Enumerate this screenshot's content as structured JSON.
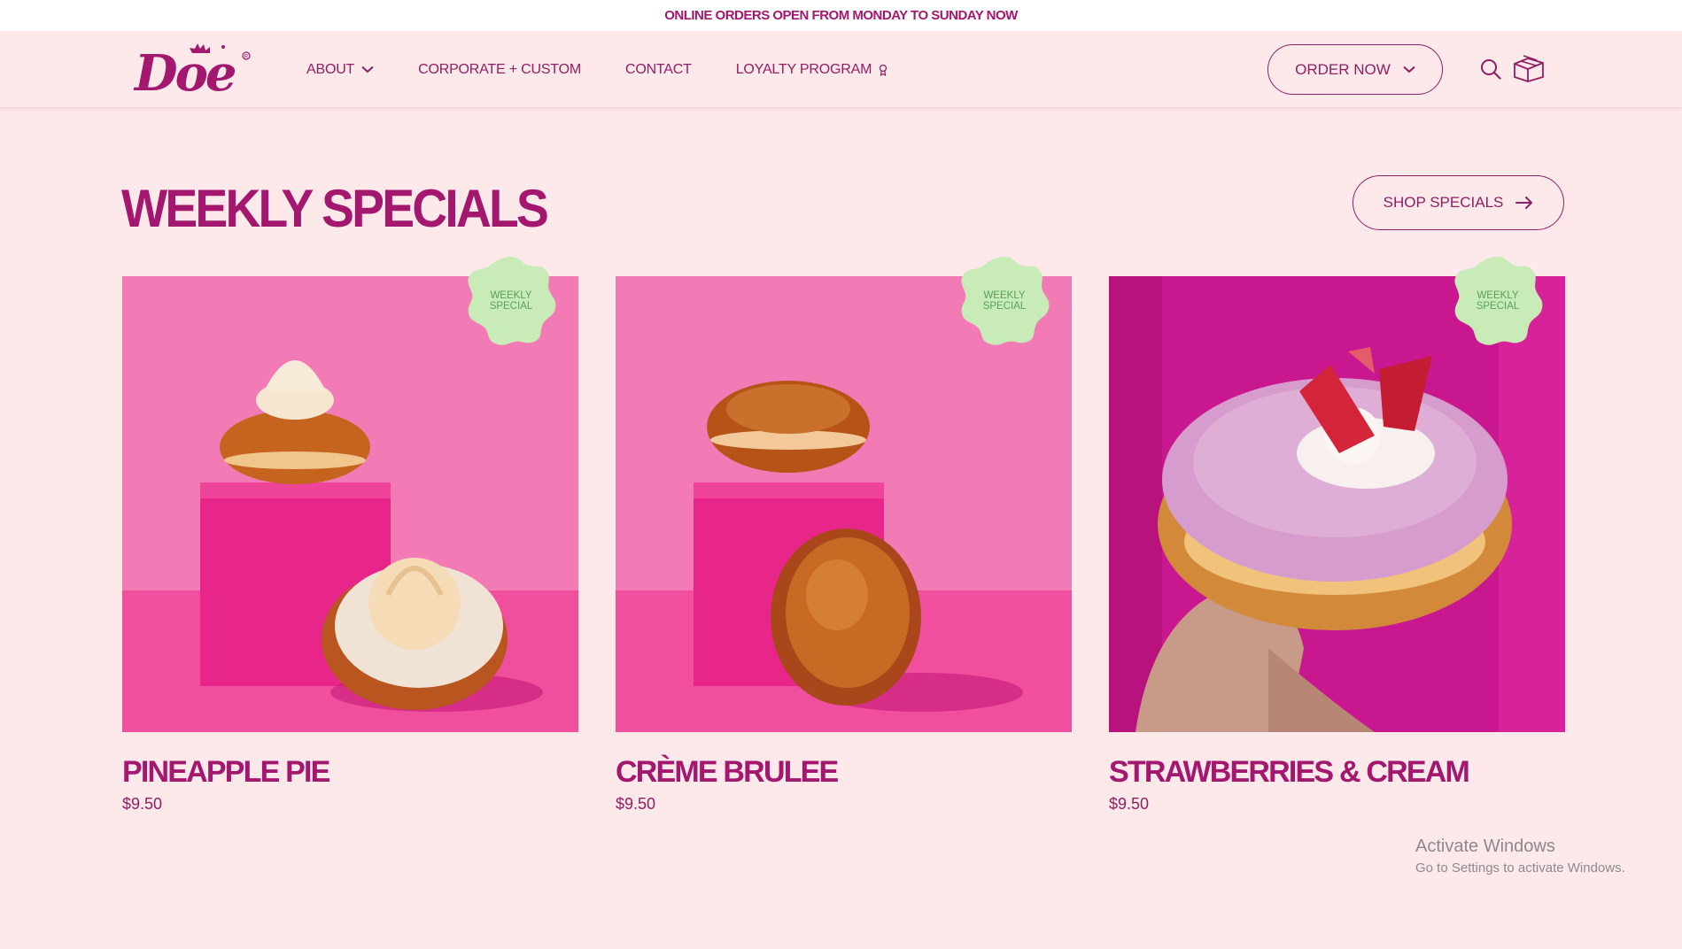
{
  "announcement": "ONLINE ORDERS OPEN FROM MONDAY TO SUNDAY NOW",
  "brand": {
    "logo_text": "Doe",
    "logo_icon": "sparkle-crown-icon"
  },
  "nav": {
    "items": [
      {
        "label": "ABOUT",
        "icon": "chevron-down-icon"
      },
      {
        "label": "CORPORATE + CUSTOM"
      },
      {
        "label": "CONTACT"
      },
      {
        "label": "LOYALTY PROGRAM",
        "icon": "award-icon"
      }
    ]
  },
  "header": {
    "order_label": "ORDER NOW",
    "search_icon": "search-icon",
    "cart_icon": "box-icon"
  },
  "specials": {
    "title": "WEEKLY SPECIALS",
    "shop_label": "SHOP SPECIALS",
    "badge_line1": "WEEKLY",
    "badge_line2": "SPECIAL",
    "products": [
      {
        "name": "PINEAPPLE PIE",
        "price": "$9.50"
      },
      {
        "name": "CRÈME BRULEE",
        "price": "$9.50"
      },
      {
        "name": "STRAWBERRIES & CREAM",
        "price": "$9.50"
      }
    ]
  },
  "watermark": {
    "line1": "Activate Windows",
    "line2": "Go to Settings to activate Windows."
  },
  "colors": {
    "brand": "#a3176e",
    "background": "#fde8ea",
    "badge": "#c9ebb8",
    "badge_text": "#5aa05a"
  }
}
